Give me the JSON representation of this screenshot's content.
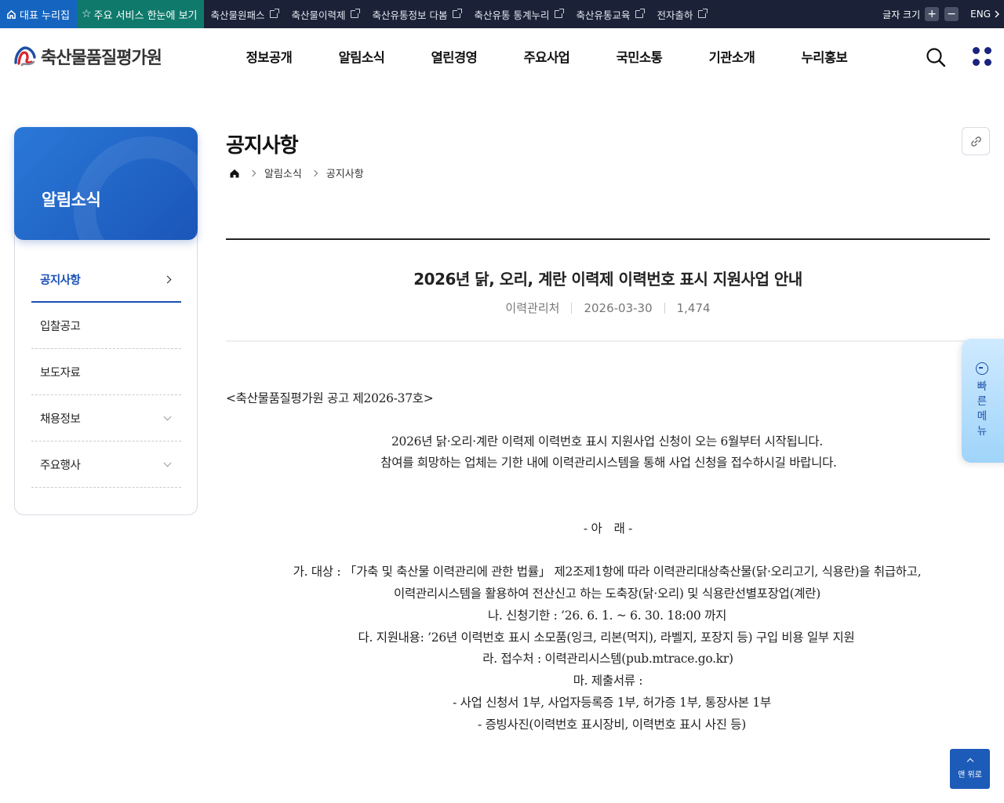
{
  "topbar": {
    "home_label": "대표 누리집",
    "star_label": "주요 서비스 한눈에 보기",
    "links": [
      "축산물원패스",
      "축산물이력제",
      "축산유통정보 다봄",
      "축산유통 통계누리",
      "축산유통교육",
      "전자출하"
    ],
    "font_size_label": "글자 크기",
    "plus": "+",
    "minus": "−",
    "lang": "ENG"
  },
  "header": {
    "logo_text": "축산물품질평가원",
    "gnb": [
      "정보공개",
      "알림소식",
      "열린경영",
      "주요사업",
      "국민소통",
      "기관소개",
      "누리홍보"
    ]
  },
  "side": {
    "title": "알림소식",
    "items": [
      {
        "label": "공지사항",
        "active": true
      },
      {
        "label": "입찰공고"
      },
      {
        "label": "보도자료"
      },
      {
        "label": "채용정보",
        "expandable": true
      },
      {
        "label": "주요행사",
        "expandable": true
      }
    ]
  },
  "content": {
    "page_title": "공지사항",
    "breadcrumb": [
      "알림소식",
      "공지사항"
    ],
    "article_title": "2026년 닭, 오리, 계란 이력제 이력번호 표시 지원사업 안내",
    "meta": {
      "department": "이력관리처",
      "date": "2026-03-30",
      "views": "1,474"
    },
    "body": {
      "notice_no": "<축산물품질평가원 공고 제2026-37호>",
      "intro1": "2026년 닭·오리·계란 이력제 이력번호 표시 지원사업 신청이 오는 6월부터 시작됩니다.",
      "intro2": "참여를 희망하는 업체는 기한 내에 이력관리시스템을 통해 사업 신청을 접수하시길 바랍니다.",
      "heading": "- 아　래 -",
      "line1": "가. 대상 : 「가축 및 축산물 이력관리에 관한 법률」 제2조제1항에 따라 이력관리대상축산물(닭·오리고기, 식용란)을 취급하고,",
      "line2": "이력관리시스템을 활용하여 전산신고 하는 도축장(닭·오리) 및 식용란선별포장업(계란)",
      "line3": "나. 신청기한 : ’26. 6. 1. ~ 6. 30. 18:00 까지",
      "line4": "다. 지원내용: ’26년 이력번호 표시 소모품(잉크, 리본(먹지), 라벨지, 포장지 등) 구입 비용 일부 지원",
      "line5": "라. 접수처 : 이력관리시스템(pub.mtrace.go.kr)",
      "line6": "마. 제출서류 :",
      "line7": "- 사업 신청서 1부, 사업자등록증 1부, 허가증 1부, 통장사본 1부",
      "line8": "- 증빙사진(이력번호 표시장비, 이력번호 표시 사진 등)"
    }
  },
  "quick_menu": {
    "label": "빠른메뉴"
  },
  "to_top": {
    "label": "맨 위로"
  }
}
